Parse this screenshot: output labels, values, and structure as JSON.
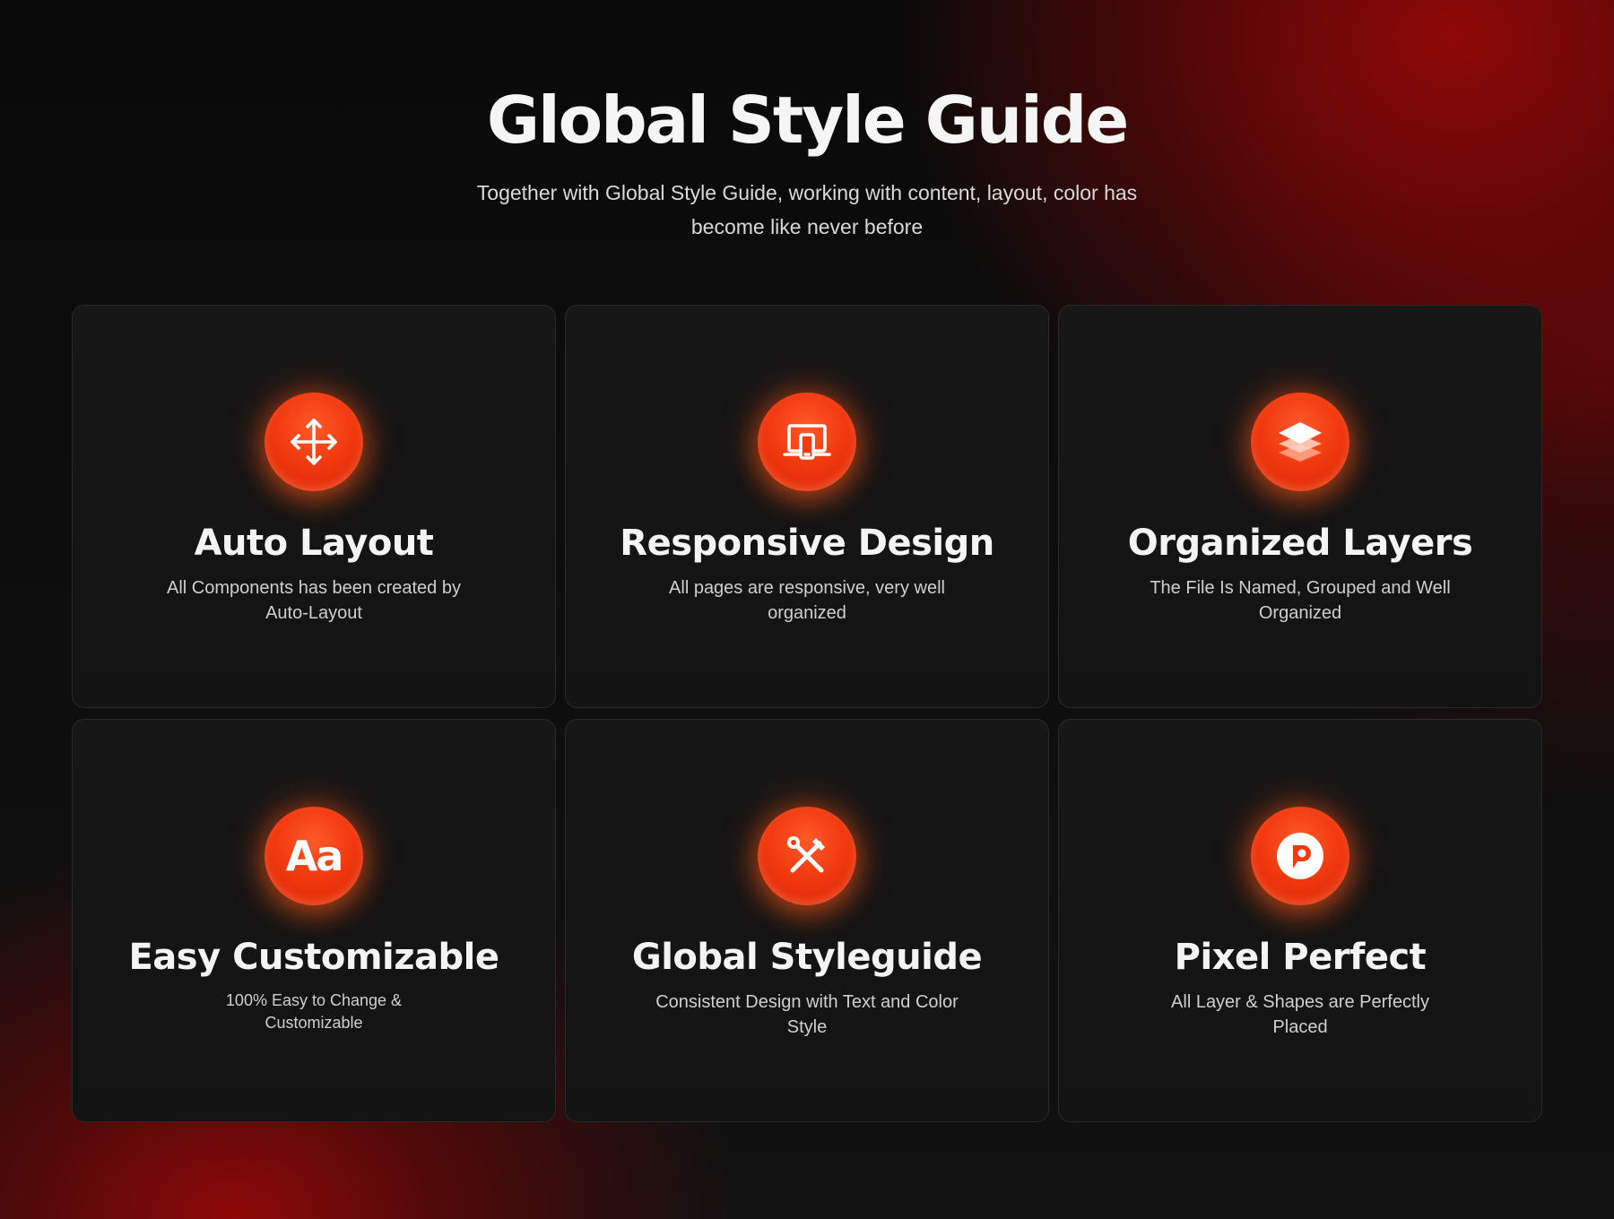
{
  "header": {
    "title": "Global Style Guide",
    "subtitle": "Together with Global Style Guide, working with content, layout, color has become like never before"
  },
  "colors": {
    "accent": "#f23a10",
    "background": "#0b0b0b",
    "card": "#151515",
    "glow_red": "#960808"
  },
  "features": [
    {
      "icon": "move-arrows-icon",
      "title": "Auto Layout",
      "description": "All Components has been created by Auto-Layout"
    },
    {
      "icon": "responsive-devices-icon",
      "title": "Responsive Design",
      "description": "All pages are responsive, very well organized"
    },
    {
      "icon": "layers-icon",
      "title": "Organized Layers",
      "description": "The File Is Named, Grouped and Well Organized"
    },
    {
      "icon": "font-aa-icon",
      "icon_text": "Aa",
      "title": "Easy Customizable",
      "description": "100% Easy to Change & Customizable"
    },
    {
      "icon": "tools-icon",
      "title": "Global Styleguide",
      "description": "Consistent Design with Text and Color Style"
    },
    {
      "icon": "pixel-perfect-icon",
      "title": "Pixel Perfect",
      "description": "All Layer & Shapes are Perfectly Placed"
    }
  ]
}
